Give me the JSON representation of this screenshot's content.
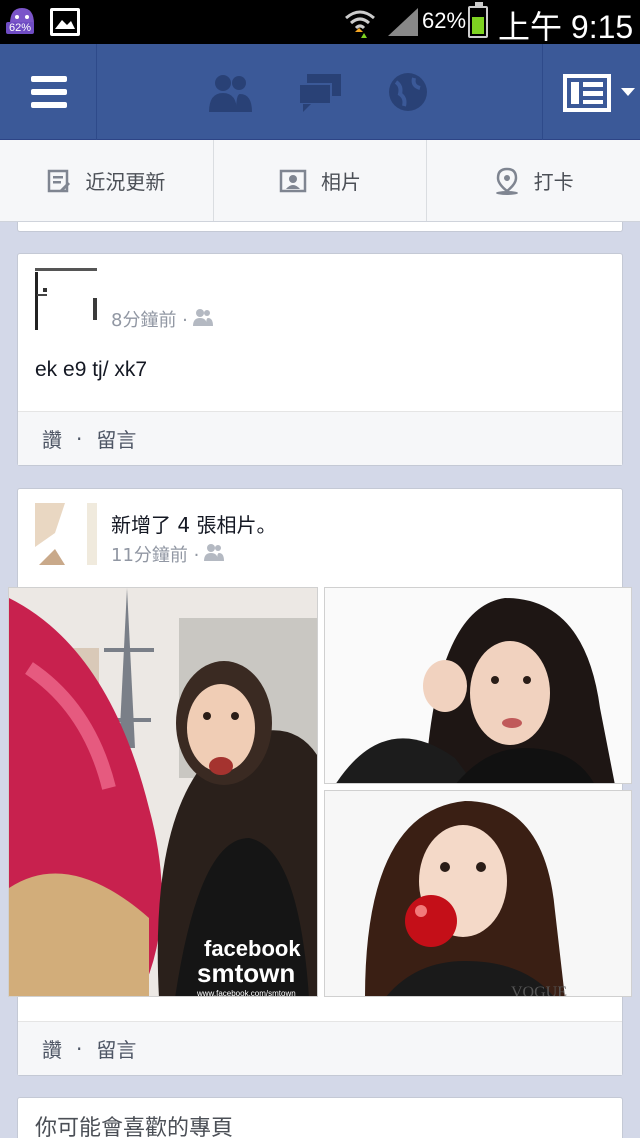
{
  "status_bar": {
    "app_badge": "62%",
    "battery_percent": "62%",
    "time": "上午 9:15"
  },
  "header": {
    "icons": [
      "menu-icon",
      "friend-requests-icon",
      "messages-icon",
      "notifications-globe-icon",
      "news-feed-menu-icon"
    ]
  },
  "tabs": [
    {
      "label": "近況更新",
      "icon": "status-edit-icon"
    },
    {
      "label": "相片",
      "icon": "photo-icon"
    },
    {
      "label": "打卡",
      "icon": "location-pin-icon"
    }
  ],
  "post1": {
    "time": "8分鐘前 ·",
    "text": "ek e9 tj/ xk7",
    "actions": {
      "like": "讚",
      "separator": "·",
      "comment": "留言"
    }
  },
  "post2": {
    "headline": "新增了 4 張相片。",
    "time": "11分鐘前 ·",
    "photo_caption_1": "facebook",
    "photo_caption_2": "smtown",
    "photo_caption_url": "www.facebook.com/smtown",
    "magazine_label": "VOGUE",
    "actions": {
      "like": "讚",
      "separator": "·",
      "comment": "留言"
    }
  },
  "suggested": {
    "title": "你可能會喜歡的專頁"
  },
  "colors": {
    "brand": "#3b5998",
    "background": "#d3d8e8",
    "battery": "#7ed321"
  }
}
